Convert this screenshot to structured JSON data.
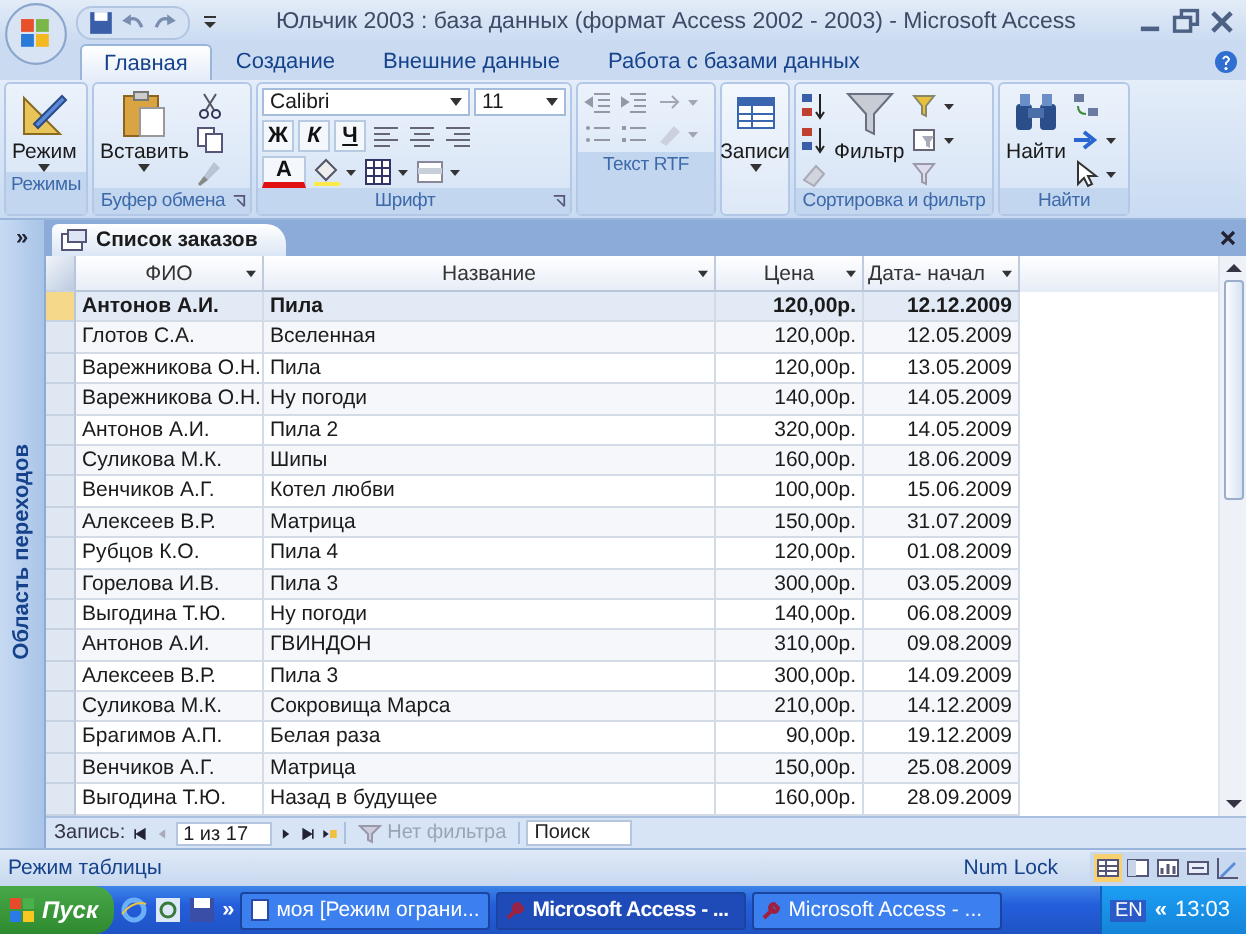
{
  "title_bar": {
    "title": "Юльчик 2003 : база данных (формат Access 2002 - 2003) - Microsoft Access"
  },
  "ribbon_tabs": [
    {
      "label": "Главная",
      "selected": true
    },
    {
      "label": "Создание",
      "selected": false
    },
    {
      "label": "Внешние данные",
      "selected": false
    },
    {
      "label": "Работа с базами данных",
      "selected": false
    }
  ],
  "ribbon": {
    "groups": [
      "Режимы",
      "Буфер обмена",
      "Шрифт",
      "Текст RTF",
      "Сортировка и фильтр",
      "Найти"
    ],
    "mode_button": "Режим",
    "paste_button": "Вставить",
    "font": "Calibri",
    "font_size": "11",
    "bold": "Ж",
    "italic": "К",
    "underline": "Ч",
    "font_color": "A",
    "records_button": "Записи",
    "filter_button": "Фильтр",
    "find_button": "Найти"
  },
  "document": {
    "tab": "Список заказов",
    "nav_toggle": "»",
    "nav_label": "Область переходов"
  },
  "table": {
    "columns": [
      "ФИО",
      "Название",
      "Цена",
      "Дата- начал"
    ],
    "rows": [
      {
        "selected": true,
        "cells": [
          "Антонов А.И.",
          "Пила",
          "120,00р.",
          "12.12.2009"
        ]
      },
      {
        "selected": false,
        "cells": [
          "Глотов С.А.",
          "Вселенная",
          "120,00р.",
          "12.05.2009"
        ]
      },
      {
        "selected": false,
        "cells": [
          "Варежникова О.Н.",
          "Пила",
          "120,00р.",
          "13.05.2009"
        ]
      },
      {
        "selected": false,
        "cells": [
          "Варежникова О.Н.",
          "Ну погоди",
          "140,00р.",
          "14.05.2009"
        ]
      },
      {
        "selected": false,
        "cells": [
          "Антонов А.И.",
          "Пила 2",
          "320,00р.",
          "14.05.2009"
        ]
      },
      {
        "selected": false,
        "cells": [
          "Суликова М.К.",
          "Шипы",
          "160,00р.",
          "18.06.2009"
        ]
      },
      {
        "selected": false,
        "cells": [
          "Венчиков А.Г.",
          "Котел любви",
          "100,00р.",
          "15.06.2009"
        ]
      },
      {
        "selected": false,
        "cells": [
          "Алексеев В.Р.",
          "Матрица",
          "150,00р.",
          "31.07.2009"
        ]
      },
      {
        "selected": false,
        "cells": [
          "Рубцов К.О.",
          "Пила 4",
          "120,00р.",
          "01.08.2009"
        ]
      },
      {
        "selected": false,
        "cells": [
          "Горелова И.В.",
          "Пила 3",
          "300,00р.",
          "03.05.2009"
        ]
      },
      {
        "selected": false,
        "cells": [
          "Выгодина Т.Ю.",
          "Ну погоди",
          "140,00р.",
          "06.08.2009"
        ]
      },
      {
        "selected": false,
        "cells": [
          "Антонов А.И.",
          "ГВИНДОН",
          "310,00р.",
          "09.08.2009"
        ]
      },
      {
        "selected": false,
        "cells": [
          "Алексеев В.Р.",
          "Пила 3",
          "300,00р.",
          "14.09.2009"
        ]
      },
      {
        "selected": false,
        "cells": [
          "Суликова М.К.",
          "Сокровища Марса",
          "210,00р.",
          "14.12.2009"
        ]
      },
      {
        "selected": false,
        "cells": [
          "Брагимов А.П.",
          "Белая раза",
          "90,00р.",
          "19.12.2009"
        ]
      },
      {
        "selected": false,
        "cells": [
          "Венчиков А.Г.",
          "Матрица",
          "150,00р.",
          "25.08.2009"
        ]
      },
      {
        "selected": false,
        "cells": [
          "Выгодина Т.Ю.",
          "Назад в будущее",
          "160,00р.",
          "28.09.2009"
        ]
      }
    ]
  },
  "record_nav": {
    "label": "Запись:",
    "position": "1 из 17",
    "filter": "Нет фильтра",
    "filter_disabled": true,
    "search_placeholder": "Поиск"
  },
  "status_bar": {
    "mode": "Режим таблицы",
    "num_lock": "Num Lock"
  },
  "taskbar": {
    "start": "Пуск",
    "overflow": "»",
    "tasks": [
      {
        "label": "моя [Режим ограни...",
        "selected": false
      },
      {
        "label": "Microsoft Access - ...",
        "selected": true
      },
      {
        "label": "Microsoft Access - ...",
        "selected": false
      }
    ],
    "language": "EN",
    "tray_toggle": "«",
    "clock": "13:03"
  }
}
